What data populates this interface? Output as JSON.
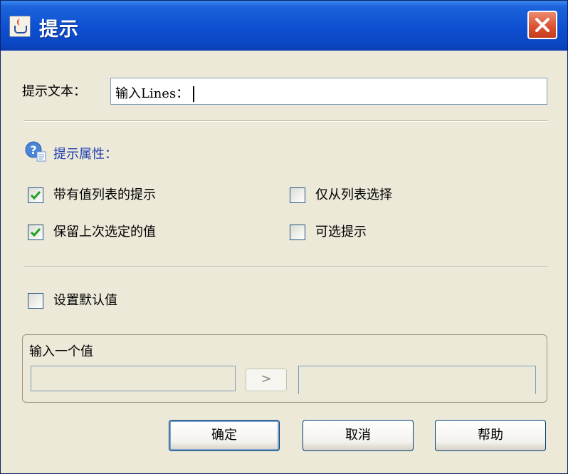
{
  "window": {
    "title": "提示"
  },
  "prompt_row": {
    "label": "提示文本：",
    "value": "输入Lines："
  },
  "properties": {
    "title": "提示属性：",
    "options": [
      {
        "label": "带有值列表的提示",
        "checked": true
      },
      {
        "label": "仅从列表选择",
        "checked": false
      },
      {
        "label": "保留上次选定的值",
        "checked": true
      },
      {
        "label": "可选提示",
        "checked": false
      }
    ]
  },
  "default_value": {
    "label": "设置默认值",
    "checked": false
  },
  "value_group": {
    "title": "输入一个值",
    "arrow_label": ">"
  },
  "buttons": {
    "ok": "确定",
    "cancel": "取消",
    "help": "帮助"
  },
  "colors": {
    "title_bar": "#0d4fd0",
    "section_title": "#1f3fb0",
    "check": "#21a121",
    "close": "#d8502f"
  }
}
